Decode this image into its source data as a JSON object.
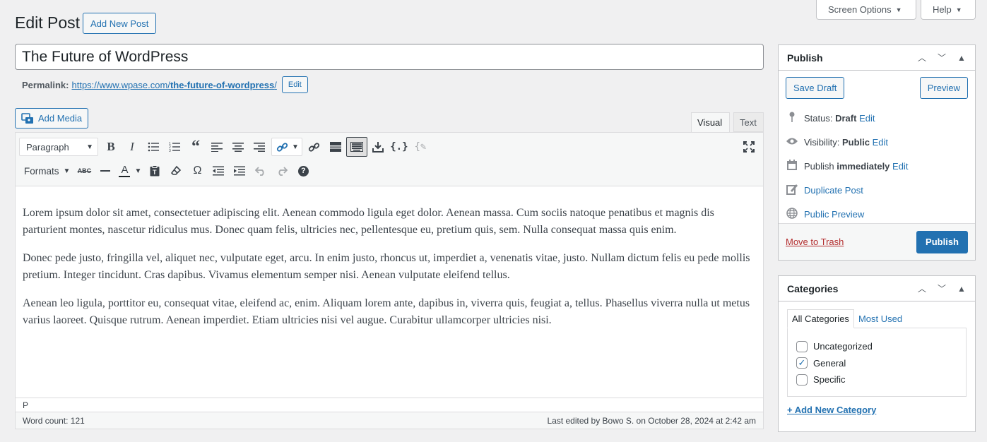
{
  "header": {
    "page_title": "Edit Post",
    "add_new_label": "Add New Post",
    "screen_options_label": "Screen Options",
    "help_label": "Help"
  },
  "post": {
    "title": "The Future of WordPress",
    "permalink_label": "Permalink:",
    "permalink_base": "https://www.wpase.com/",
    "permalink_slug": "the-future-of-wordpress",
    "permalink_trailing": "/",
    "permalink_edit_label": "Edit"
  },
  "editor": {
    "add_media_label": "Add Media",
    "tab_visual": "Visual",
    "tab_text": "Text",
    "block_format": "Paragraph",
    "formats_label": "Formats",
    "paragraphs": [
      "Lorem ipsum dolor sit amet, consectetuer adipiscing elit. Aenean commodo ligula eget dolor. Aenean massa. Cum sociis natoque penatibus et magnis dis parturient montes, nascetur ridiculus mus. Donec quam felis, ultricies nec, pellentesque eu, pretium quis, sem. Nulla consequat massa quis enim.",
      "Donec pede justo, fringilla vel, aliquet nec, vulputate eget, arcu. In enim justo, rhoncus ut, imperdiet a, venenatis vitae, justo. Nullam dictum felis eu pede mollis pretium. Integer tincidunt. Cras dapibus. Vivamus elementum semper nisi. Aenean vulputate eleifend tellus.",
      "Aenean leo ligula, porttitor eu, consequat vitae, eleifend ac, enim. Aliquam lorem ante, dapibus in, viverra quis, feugiat a, tellus. Phasellus viverra nulla ut metus varius laoreet. Quisque rutrum. Aenean imperdiet. Etiam ultricies nisi vel augue. Curabitur ullamcorper ultricies nisi."
    ],
    "path": "P",
    "word_count": "Word count: 121",
    "last_edited": "Last edited by Bowo S. on October 28, 2024 at 2:42 am"
  },
  "publish_box": {
    "title": "Publish",
    "save_draft_label": "Save Draft",
    "preview_label": "Preview",
    "status_label": "Status:",
    "status_value": "Draft",
    "visibility_label": "Visibility:",
    "visibility_value": "Public",
    "publish_label": "Publish",
    "publish_value": "immediately",
    "edit_label": "Edit",
    "duplicate_post_label": "Duplicate Post",
    "public_preview_label": "Public Preview",
    "move_to_trash_label": "Move to Trash",
    "publish_button_label": "Publish"
  },
  "categories_box": {
    "title": "Categories",
    "tab_all": "All Categories",
    "tab_most_used": "Most Used",
    "items": [
      {
        "label": "Uncategorized",
        "checked": false
      },
      {
        "label": "General",
        "checked": true
      },
      {
        "label": "Specific",
        "checked": false
      }
    ],
    "add_new_label": "+ Add New Category"
  },
  "colors": {
    "accent": "#2271b1",
    "trash": "#b32d2e",
    "background": "#f0f0f1"
  }
}
